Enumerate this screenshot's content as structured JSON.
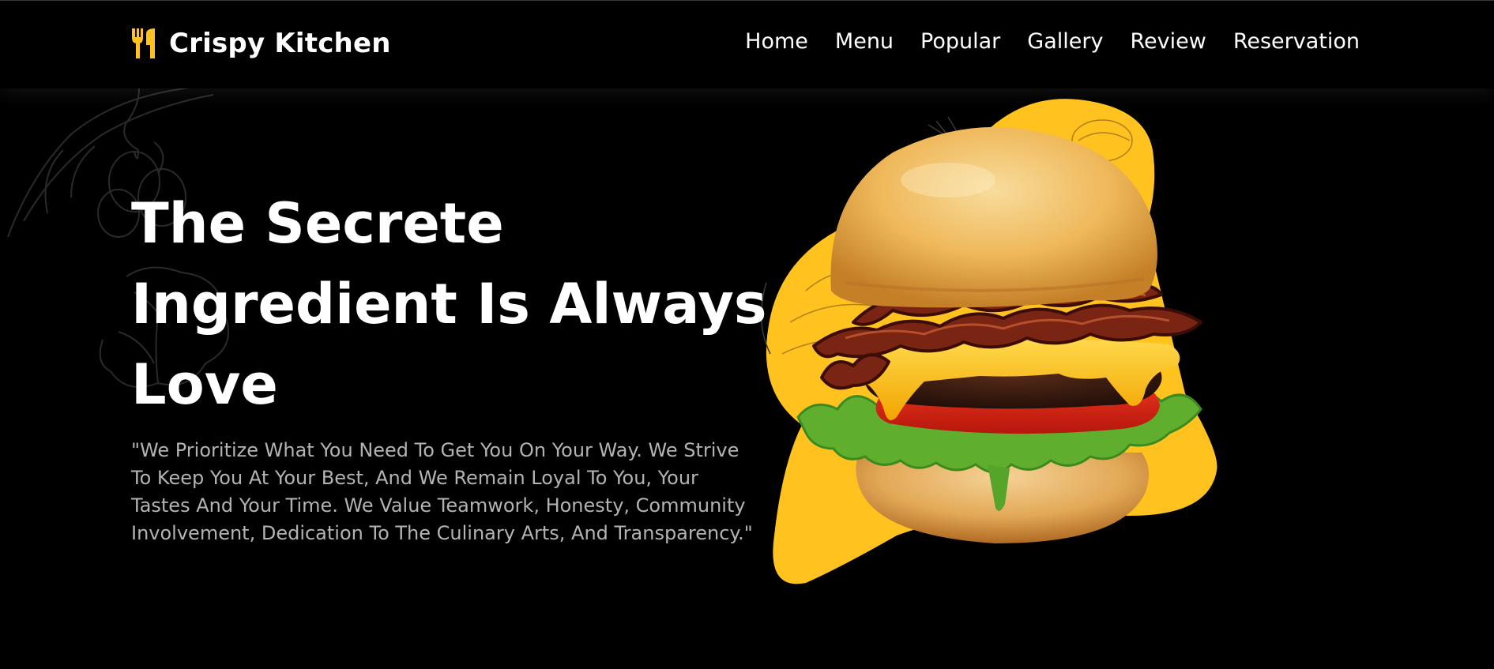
{
  "brand": {
    "name": "Crispy Kitchen",
    "icon": "fork-knife-icon",
    "accent_color": "#FFC21F"
  },
  "nav": {
    "items": [
      {
        "label": "Home"
      },
      {
        "label": "Menu"
      },
      {
        "label": "Popular"
      },
      {
        "label": "Gallery"
      },
      {
        "label": "Review"
      },
      {
        "label": "Reservation"
      }
    ]
  },
  "hero": {
    "title_lines": [
      "The Secrete",
      "Ingredient Is Always",
      "Love"
    ],
    "quote": "\"We Prioritize What You Need To Get You On Your Way. We Strive To Keep You At Your Best, And We Remain Loyal To You, Your Tastes And Your Time. We Value Teamwork, Honesty, Community Involvement, Dedication To The Culinary Arts, And Transparency.\"",
    "image": "bacon-cheeseburger-image",
    "background_color": "#000000"
  }
}
